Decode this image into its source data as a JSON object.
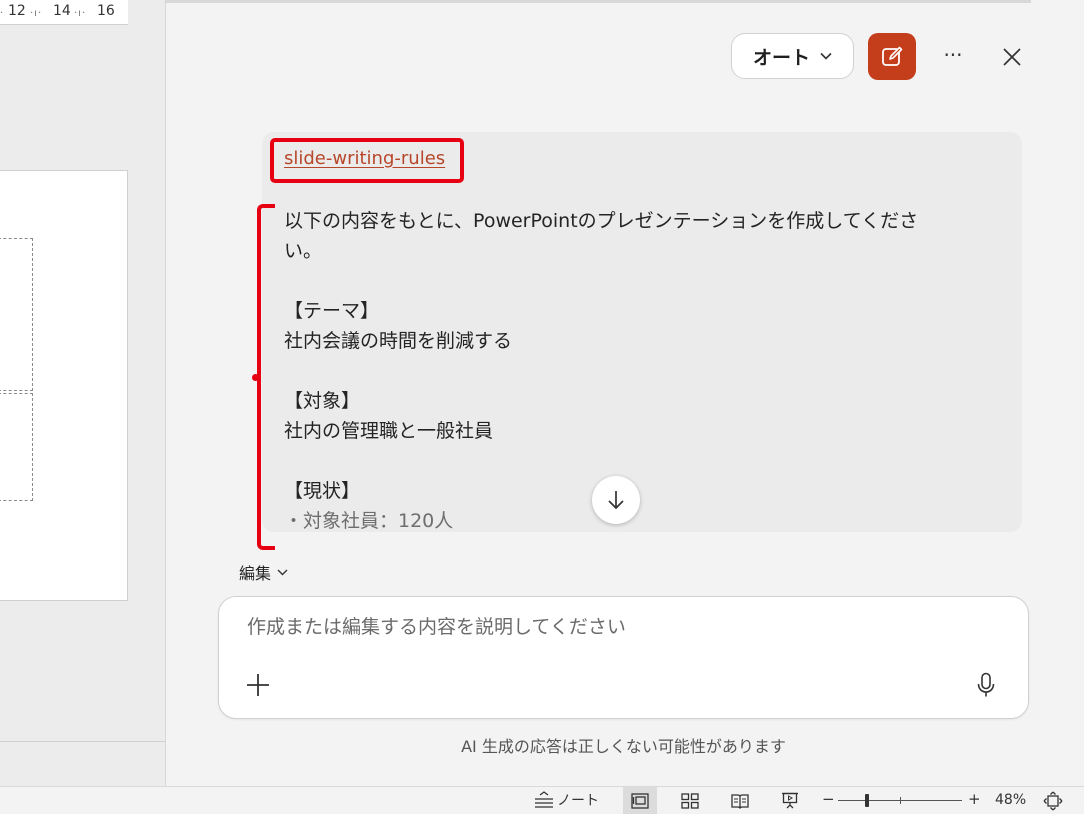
{
  "ruler": {
    "labels": [
      "12",
      "14",
      "16"
    ]
  },
  "header": {
    "mode_label": "オート",
    "more_label": "···"
  },
  "message": {
    "skill_link": "slide-writing-rules",
    "lines": [
      "以下の内容をもとに、PowerPointのプレゼンテーションを作成してくださ",
      "い。",
      "",
      "【テーマ】",
      "社内会議の時間を削減する",
      "",
      "【対象】",
      "社内の管理職と一般社員",
      "",
      "【現状】",
      "・対象社員：120人"
    ]
  },
  "edit_toggle": {
    "label": "編集"
  },
  "prompt": {
    "placeholder": "作成または編集する内容を説明してください"
  },
  "disclaimer": "AI 生成の応答は正しくない可能性があります",
  "status_bar": {
    "notes_label": "ノート",
    "zoom_minus": "−",
    "zoom_plus": "+",
    "zoom_level": "48%",
    "zoom_fraction": 0.48
  },
  "colors": {
    "accent": "#c43e1c",
    "link": "#b7472a",
    "annotation_red": "#e60012"
  },
  "icons": {
    "compose": "compose-icon",
    "close": "close-icon",
    "scroll_down": "arrow-down-icon",
    "add": "plus-icon",
    "mic": "microphone-icon"
  }
}
